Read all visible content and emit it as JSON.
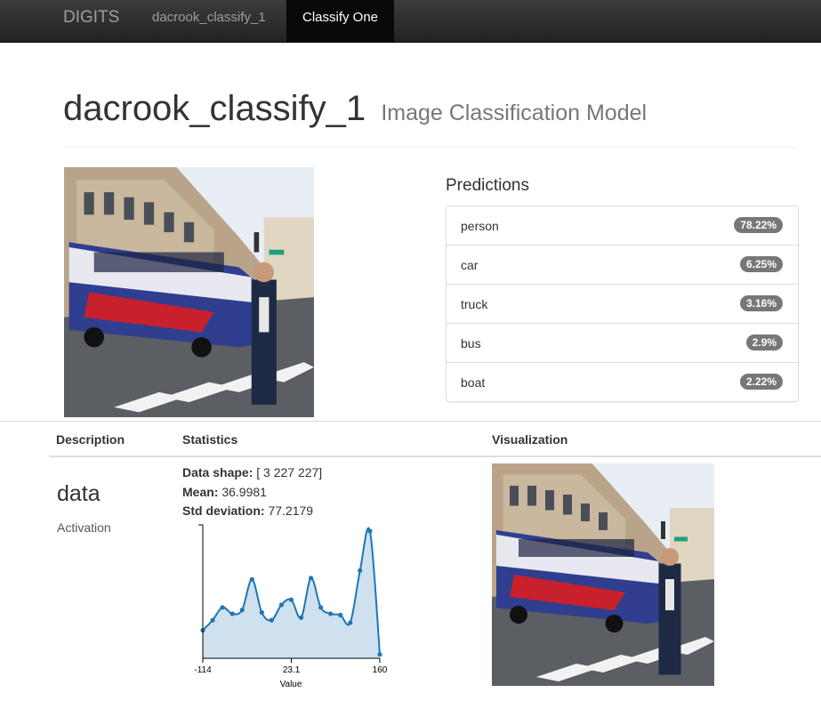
{
  "navbar": {
    "brand": "DIGITS",
    "model_link": "dacrook_classify_1",
    "active_tab": "Classify One"
  },
  "header": {
    "title": "dacrook_classify_1",
    "subtitle": "Image Classification Model"
  },
  "predictions": {
    "title": "Predictions",
    "items": [
      {
        "label": "person",
        "value": "78.22%"
      },
      {
        "label": "car",
        "value": "6.25%"
      },
      {
        "label": "truck",
        "value": "3.16%"
      },
      {
        "label": "bus",
        "value": "2.9%"
      },
      {
        "label": "boat",
        "value": "2.22%"
      }
    ]
  },
  "layers_table": {
    "headers": {
      "description": "Description",
      "statistics": "Statistics",
      "visualization": "Visualization"
    },
    "row": {
      "name": "data",
      "type": "Activation",
      "stats": [
        {
          "label": "Data shape:",
          "value": " [ 3 227 227]"
        },
        {
          "label": "Mean:",
          "value": " 36.9981"
        },
        {
          "label": "Std deviation:",
          "value": " 77.2179"
        }
      ]
    }
  },
  "colors": {
    "line": "#1f77b4",
    "fill": "#cfe0ee",
    "badge": "#777777",
    "navbar": "#222222"
  },
  "chart_data": {
    "type": "area",
    "xlabel": "Value",
    "xlim": [
      -114,
      160
    ],
    "xticks": [
      "-114",
      "23.1",
      "160"
    ],
    "x": [
      -114,
      -98.8,
      -83.6,
      -68.3,
      -53.1,
      -37.9,
      -22.7,
      -7.5,
      7.7,
      22.9,
      38.2,
      53.4,
      68.6,
      83.8,
      99.0,
      114.2,
      129.4,
      144.7,
      160
    ],
    "y": [
      0.22,
      0.3,
      0.4,
      0.35,
      0.38,
      0.62,
      0.36,
      0.3,
      0.42,
      0.46,
      0.32,
      0.63,
      0.4,
      0.35,
      0.34,
      0.28,
      0.69,
      1.0,
      0.03
    ]
  }
}
